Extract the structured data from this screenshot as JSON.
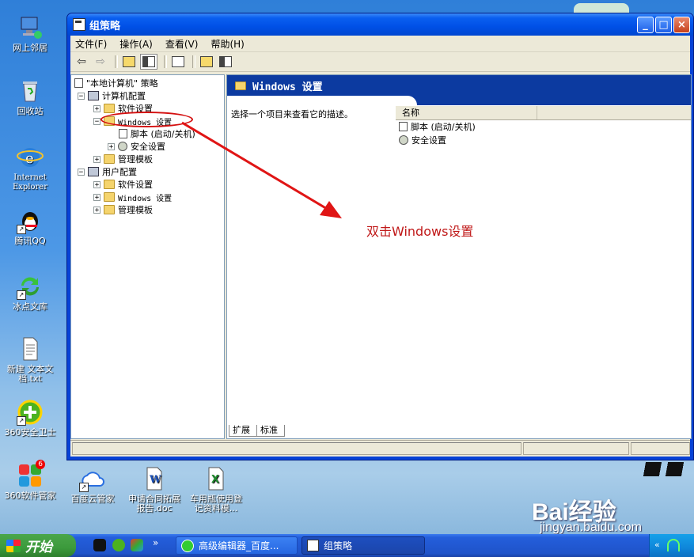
{
  "desktop": {
    "icons": [
      {
        "label": "网上邻居"
      },
      {
        "label": "回收站"
      },
      {
        "label": "Internet Explorer"
      },
      {
        "label": "腾讯QQ"
      },
      {
        "label": "冰点文库"
      },
      {
        "label": "新建 文本文档.txt"
      },
      {
        "label": "360安全卫士"
      },
      {
        "label": "360软件管家",
        "badge": "6"
      },
      {
        "label": "百度云管家"
      },
      {
        "label": "申请合同拓展报告.doc"
      },
      {
        "label": "车用瓶使用登记资料模..."
      }
    ]
  },
  "window": {
    "title": "组策略",
    "buttons": {
      "minimize": "_",
      "maximize": "□",
      "close": "×"
    },
    "menu": [
      "文件(F)",
      "操作(A)",
      "查看(V)",
      "帮助(H)"
    ],
    "tree": {
      "root": "\"本地计算机\" 策略",
      "computer_config": "计算机配置",
      "software_settings": "软件设置",
      "windows_settings": "Windows 设置",
      "scripts": "脚本 (启动/关机)",
      "security_settings": "安全设置",
      "admin_templates": "管理模板",
      "user_config": "用户配置",
      "u_software_settings": "软件设置",
      "u_windows_settings": "Windows 设置",
      "u_admin_templates": "管理模板"
    },
    "right": {
      "header": "Windows 设置",
      "description": "选择一个项目来查看它的描述。",
      "column_name": "名称",
      "items": [
        "脚本 (启动/关机)",
        "安全设置"
      ],
      "tabs": [
        "扩展",
        "标准"
      ]
    }
  },
  "annotation": {
    "text": "双击Windows设置",
    "color": "#c01818"
  },
  "taskbar": {
    "start": "开始",
    "quick_launch_more": "»",
    "tasks": [
      "高级编辑器_百度...",
      "组策略"
    ]
  },
  "watermark": {
    "brand": "Bai经验",
    "url": "jingyan.baidu.com"
  }
}
